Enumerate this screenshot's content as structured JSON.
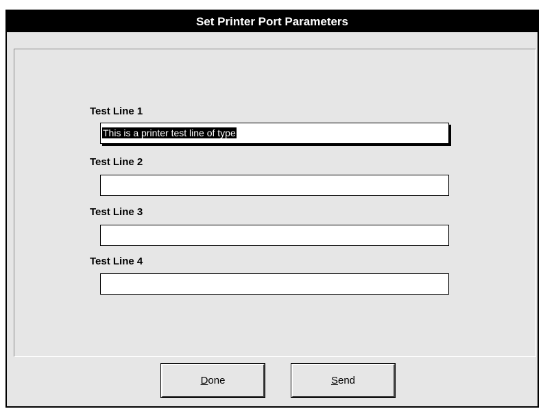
{
  "window": {
    "title": "Set Printer Port Parameters"
  },
  "fields": [
    {
      "label": "Test Line 1",
      "value": "This is a printer test line of type"
    },
    {
      "label": "Test Line 2",
      "value": ""
    },
    {
      "label": "Test Line 3",
      "value": ""
    },
    {
      "label": "Test Line 4",
      "value": ""
    }
  ],
  "buttons": {
    "done": {
      "accel": "D",
      "rest": "one"
    },
    "send": {
      "accel": "S",
      "rest": "end"
    }
  }
}
